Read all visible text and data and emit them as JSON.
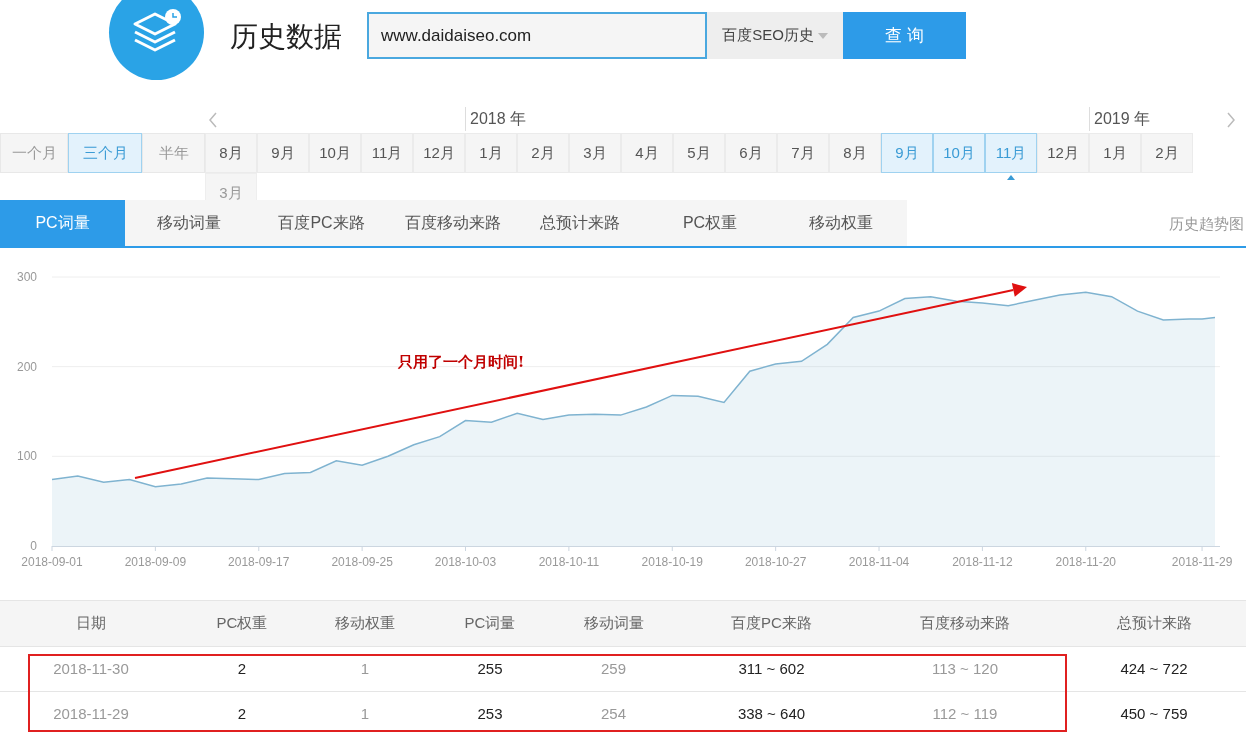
{
  "header": {
    "title": "历史数据",
    "search": {
      "value": "www.daidaiseo.com"
    },
    "dropdown": {
      "value": "百度SEO历史"
    },
    "submit_button": "查 询"
  },
  "periods": [
    {
      "label": "一个月",
      "selected": false
    },
    {
      "label": "三个月",
      "selected": true
    },
    {
      "label": "半年",
      "selected": false
    }
  ],
  "months": [
    {
      "label": "8月",
      "selected": false,
      "current": false,
      "disabled": false
    },
    {
      "label": "9月",
      "selected": false,
      "current": false,
      "disabled": false
    },
    {
      "label": "10月",
      "selected": false,
      "current": false,
      "disabled": false
    },
    {
      "label": "11月",
      "selected": false,
      "current": false,
      "disabled": false
    },
    {
      "label": "12月",
      "selected": false,
      "current": false,
      "disabled": false
    },
    {
      "label": "1月",
      "selected": false,
      "current": false,
      "disabled": false,
      "year_label": "2018 年"
    },
    {
      "label": "2月",
      "selected": false,
      "current": false,
      "disabled": false
    },
    {
      "label": "3月",
      "selected": false,
      "current": false,
      "disabled": false
    },
    {
      "label": "4月",
      "selected": false,
      "current": false,
      "disabled": false
    },
    {
      "label": "5月",
      "selected": false,
      "current": false,
      "disabled": false
    },
    {
      "label": "6月",
      "selected": false,
      "current": false,
      "disabled": false
    },
    {
      "label": "7月",
      "selected": false,
      "current": false,
      "disabled": false
    },
    {
      "label": "8月",
      "selected": false,
      "current": false,
      "disabled": false
    },
    {
      "label": "9月",
      "selected": true,
      "current": false,
      "disabled": false
    },
    {
      "label": "10月",
      "selected": true,
      "current": false,
      "disabled": false
    },
    {
      "label": "11月",
      "selected": true,
      "current": true,
      "disabled": false
    },
    {
      "label": "12月",
      "selected": false,
      "current": false,
      "disabled": false
    },
    {
      "label": "1月",
      "selected": false,
      "current": false,
      "disabled": false,
      "year_label": "2019 年"
    },
    {
      "label": "2月",
      "selected": false,
      "current": false,
      "disabled": false
    },
    {
      "label": "3月",
      "selected": false,
      "current": false,
      "disabled": true
    }
  ],
  "tabs": [
    {
      "label": "PC词量",
      "selected": true
    },
    {
      "label": "移动词量",
      "selected": false
    },
    {
      "label": "百度PC来路",
      "selected": false
    },
    {
      "label": "百度移动来路",
      "selected": false
    },
    {
      "label": "总预计来路",
      "selected": false
    },
    {
      "label": "PC权重",
      "selected": false
    },
    {
      "label": "移动权重",
      "selected": false
    }
  ],
  "trend_link": "历史趋势图",
  "chart": {
    "chart_data": {
      "type": "area",
      "xlim": [
        "2018-09-01",
        "2018-11-30"
      ],
      "ylim": [
        0,
        300
      ],
      "yticks": [
        0,
        100,
        200,
        300
      ],
      "xticks": [
        "2018-09-01",
        "2018-09-09",
        "2018-09-17",
        "2018-09-25",
        "2018-10-03",
        "2018-10-11",
        "2018-10-19",
        "2018-10-27",
        "2018-11-04",
        "2018-11-12",
        "2018-11-20",
        "2018-11-29"
      ],
      "x": [
        "2018-09-01",
        "2018-09-03",
        "2018-09-05",
        "2018-09-07",
        "2018-09-09",
        "2018-09-11",
        "2018-09-13",
        "2018-09-15",
        "2018-09-17",
        "2018-09-19",
        "2018-09-21",
        "2018-09-23",
        "2018-09-25",
        "2018-09-27",
        "2018-09-29",
        "2018-10-01",
        "2018-10-03",
        "2018-10-05",
        "2018-10-07",
        "2018-10-09",
        "2018-10-11",
        "2018-10-13",
        "2018-10-15",
        "2018-10-17",
        "2018-10-19",
        "2018-10-21",
        "2018-10-23",
        "2018-10-25",
        "2018-10-27",
        "2018-10-29",
        "2018-10-31",
        "2018-11-02",
        "2018-11-04",
        "2018-11-06",
        "2018-11-08",
        "2018-11-10",
        "2018-11-12",
        "2018-11-14",
        "2018-11-16",
        "2018-11-18",
        "2018-11-20",
        "2018-11-22",
        "2018-11-24",
        "2018-11-26",
        "2018-11-28",
        "2018-11-29",
        "2018-11-30"
      ],
      "series": [
        {
          "color": "#7fb3d0",
          "values": [
            74,
            78,
            71,
            74,
            66,
            69,
            76,
            75,
            74,
            81,
            82,
            95,
            90,
            100,
            113,
            122,
            140,
            138,
            148,
            141,
            146,
            147,
            146,
            155,
            168,
            167,
            160,
            195,
            203,
            206,
            225,
            255,
            262,
            276,
            278,
            273,
            271,
            268,
            274,
            280,
            283,
            278,
            262,
            252,
            253,
            253,
            255
          ]
        }
      ],
      "annotations": [
        "只用了一个月时间!"
      ]
    }
  },
  "table": {
    "columns": [
      "日期",
      "PC权重",
      "移动权重",
      "PC词量",
      "移动词量",
      "百度PC来路",
      "百度移动来路",
      "总预计来路"
    ],
    "rows": [
      {
        "cells": [
          "2018-11-30",
          "2",
          "1",
          "255",
          "259",
          "311 ~ 602",
          "113 ~ 120",
          "424 ~ 722"
        ],
        "highlighted": true
      },
      {
        "cells": [
          "2018-11-29",
          "2",
          "1",
          "253",
          "254",
          "338 ~ 640",
          "112 ~ 119",
          "450 ~ 759"
        ],
        "highlighted": true
      }
    ]
  }
}
